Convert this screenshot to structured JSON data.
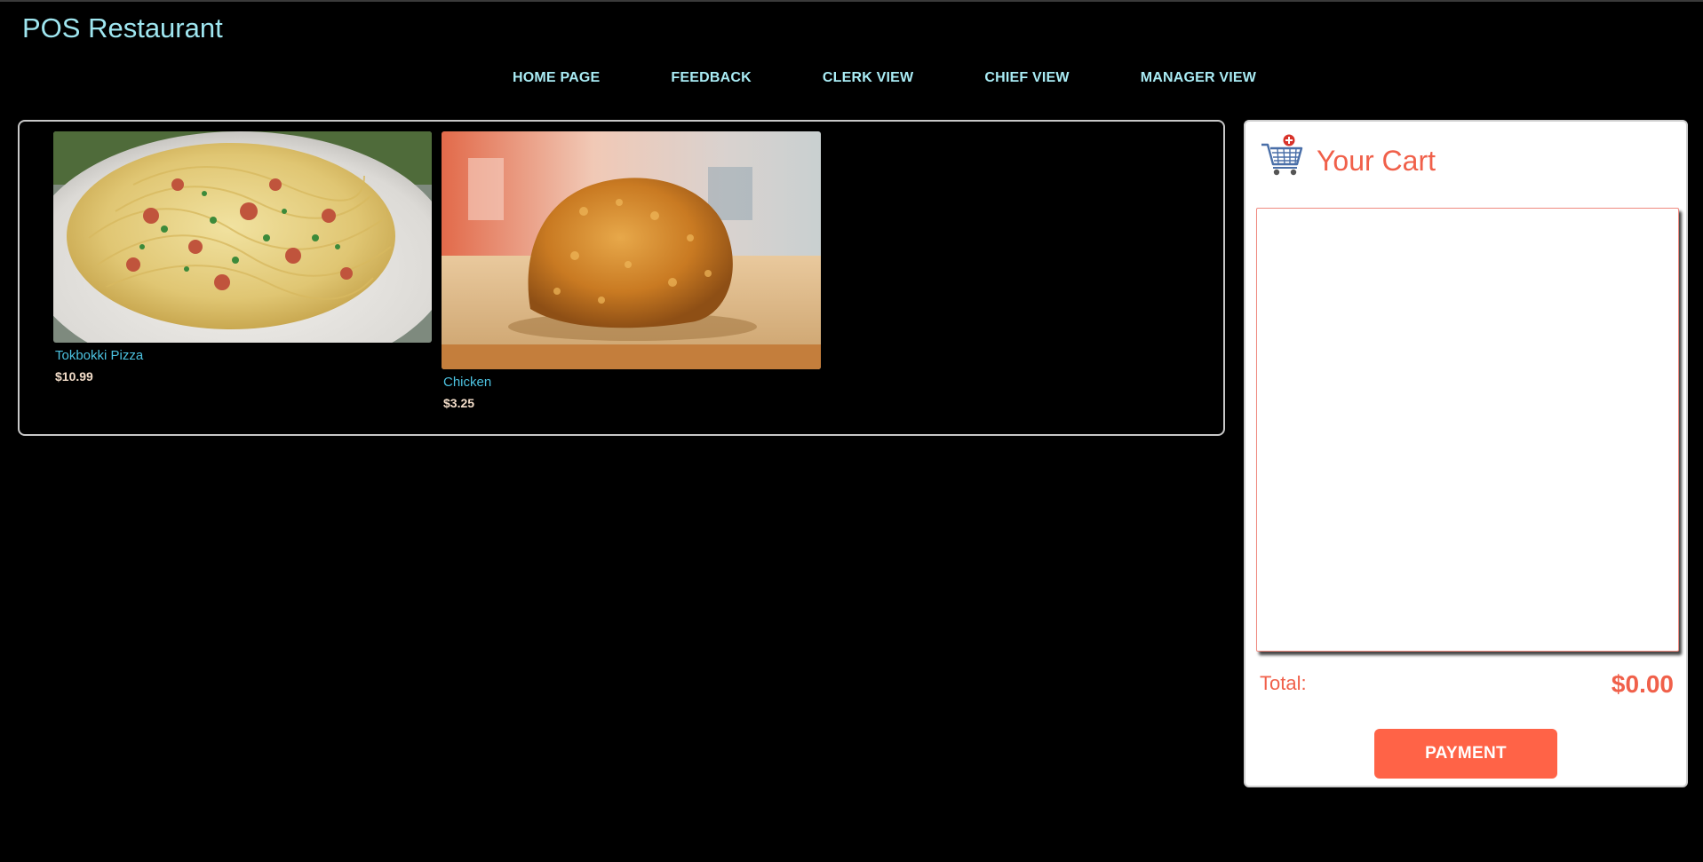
{
  "app": {
    "title": "POS Restaurant"
  },
  "nav": {
    "items": [
      "HOME PAGE",
      "FEEDBACK",
      "CLERK VIEW",
      "CHIEF VIEW",
      "MANAGER VIEW"
    ]
  },
  "products": [
    {
      "name": "Tokbokki Pizza",
      "price": "$10.99",
      "image": "spaghetti-plate"
    },
    {
      "name": "Chicken",
      "price": "$3.25",
      "image": "fried-chicken-on-board"
    }
  ],
  "cart": {
    "title": "Your Cart",
    "icon": "shopping-cart-add-icon",
    "total_label": "Total:",
    "total_value": "$0.00",
    "payment_label": "PAYMENT"
  },
  "colors": {
    "accent": "#ff6347",
    "cart_text": "#f0604a",
    "brand": "#9fe6f0",
    "product_name": "#4cc2e0"
  }
}
